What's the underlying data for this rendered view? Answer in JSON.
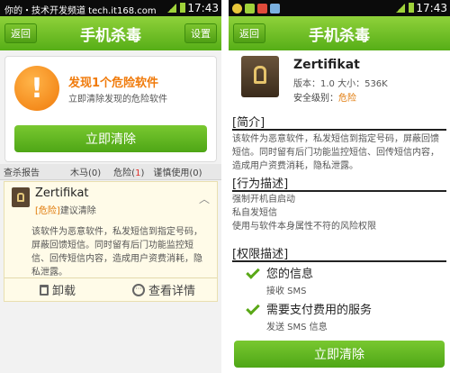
{
  "left": {
    "watermark": "你的・技术开发频道 tech.it168.com",
    "time": "17:43",
    "header": {
      "back": "返回",
      "title": "手机杀毒",
      "settings": "设置"
    },
    "alert": {
      "icon": "warning-icon",
      "title": "发现1个危险软件",
      "subtitle": "立即清除发现的危险软件",
      "button": "立即清除"
    },
    "tabs": {
      "report": "查杀报告",
      "trojan": "木马(0)",
      "danger_prefix": "危险(",
      "danger_count": "1",
      "danger_suffix": ")",
      "caution": "谨慎使用(0)"
    },
    "item": {
      "name": "Zertifikat",
      "tag": "[危险]",
      "advice": "建议清除",
      "desc": "该软件为恶意软件，私发短信到指定号码，屏蔽回馈短信。同时留有后门功能监控短信、回传短信内容，造成用户资费消耗，隐私泄露。",
      "uninstall": "卸载",
      "details": "查看详情"
    }
  },
  "right": {
    "time": "17:43",
    "header": {
      "back": "返回",
      "title": "手机杀毒"
    },
    "app": {
      "name": "Zertifikat",
      "meta": "版本：1.0   大小：536K",
      "safe_label": "安全级别：",
      "safe_level": "危险"
    },
    "intro": {
      "title": "[简介]",
      "body": "该软件为恶意软件，私发短信到指定号码，屏蔽回馈短信。同时留有后门功能监控短信、回传短信内容，造成用户资费消耗，隐私泄露。"
    },
    "behavior": {
      "title": "[行为描述]",
      "lines": [
        "强制开机自启动",
        "私自发短信",
        "使用与软件本身属性不符的风险权限"
      ]
    },
    "perm": {
      "title": "[权限描述]",
      "items": [
        {
          "title": "您的信息",
          "sub": "接收 SMS"
        },
        {
          "title": "需要支付费用的服务",
          "sub": "发送 SMS 信息"
        }
      ]
    },
    "button": "立即清除"
  },
  "colors": {
    "green": "#56ae17",
    "orange": "#f07a0a",
    "danger_red": "#e0322c"
  }
}
